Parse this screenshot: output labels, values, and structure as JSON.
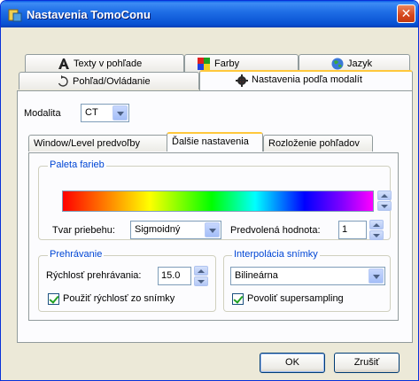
{
  "window": {
    "title": "Nastavenia TomoConu",
    "close_label": "✕"
  },
  "outer_tabs": {
    "row1": [
      {
        "label": "Texty v pohľade",
        "icon": "text-a-icon"
      },
      {
        "label": "Farby",
        "icon": "color-palette-icon"
      },
      {
        "label": "Jazyk",
        "icon": "globe-icon"
      }
    ],
    "row2": [
      {
        "label": "Pohľad/Ovládanie",
        "icon": "rotate-arrow-icon"
      },
      {
        "label": "Nastavenia podľa modalít",
        "icon": "modality-gear-icon",
        "active": true
      }
    ]
  },
  "modality": {
    "label": "Modalita",
    "value": "CT"
  },
  "inner_tabs": [
    {
      "label": "Window/Level predvoľby"
    },
    {
      "label": "Ďalšie nastavenia",
      "active": true
    },
    {
      "label": "Rozloženie pohľadov"
    }
  ],
  "palette_group": {
    "title": "Paleta farieb",
    "curve_label": "Tvar priebehu:",
    "curve_value": "Sigmoidný",
    "default_label": "Predvolená hodnota:",
    "default_value": "1"
  },
  "playback_group": {
    "title": "Prehrávanie",
    "speed_label": "Rýchlosť prehrávania:",
    "speed_value": "15.0",
    "use_image_speed_label": "Použiť rýchlosť zo snímky",
    "use_image_speed_checked": true
  },
  "interpolation_group": {
    "title": "Interpolácia snímky",
    "method_value": "Bilineárna",
    "supersampling_label": "Povoliť supersampling",
    "supersampling_checked": true
  },
  "buttons": {
    "ok": "OK",
    "cancel": "Zrušiť"
  }
}
